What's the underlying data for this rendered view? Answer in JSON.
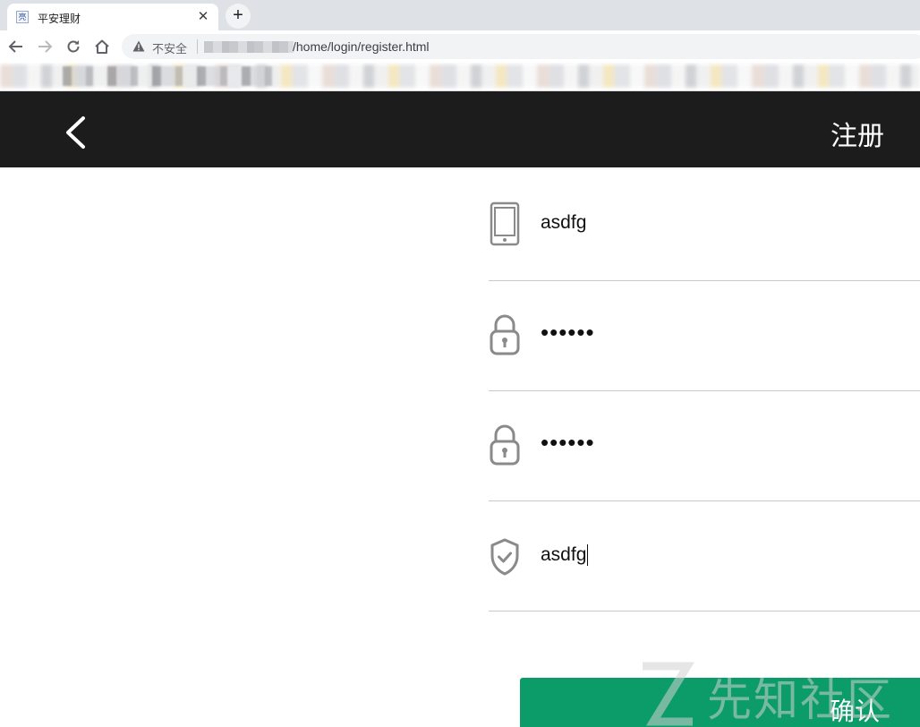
{
  "browser": {
    "tab_title": "平安理财",
    "tab_favicon": "亮",
    "tab_close": "✕",
    "new_tab": "+",
    "security_label": "不安全",
    "url_path": "/home/login/register.html"
  },
  "header": {
    "title": "注册"
  },
  "form": {
    "phone_value": "asdfg",
    "password_value": "••••••",
    "confirm_password_value": "••••••",
    "code_value": "asdfg"
  },
  "confirm_button": {
    "label": "确认"
  },
  "watermark": {
    "text": "先知社区"
  },
  "colors": {
    "header_bg": "#1c1c1c",
    "button_bg": "#0c9c6a",
    "icon_gray": "#8a8a8a"
  }
}
